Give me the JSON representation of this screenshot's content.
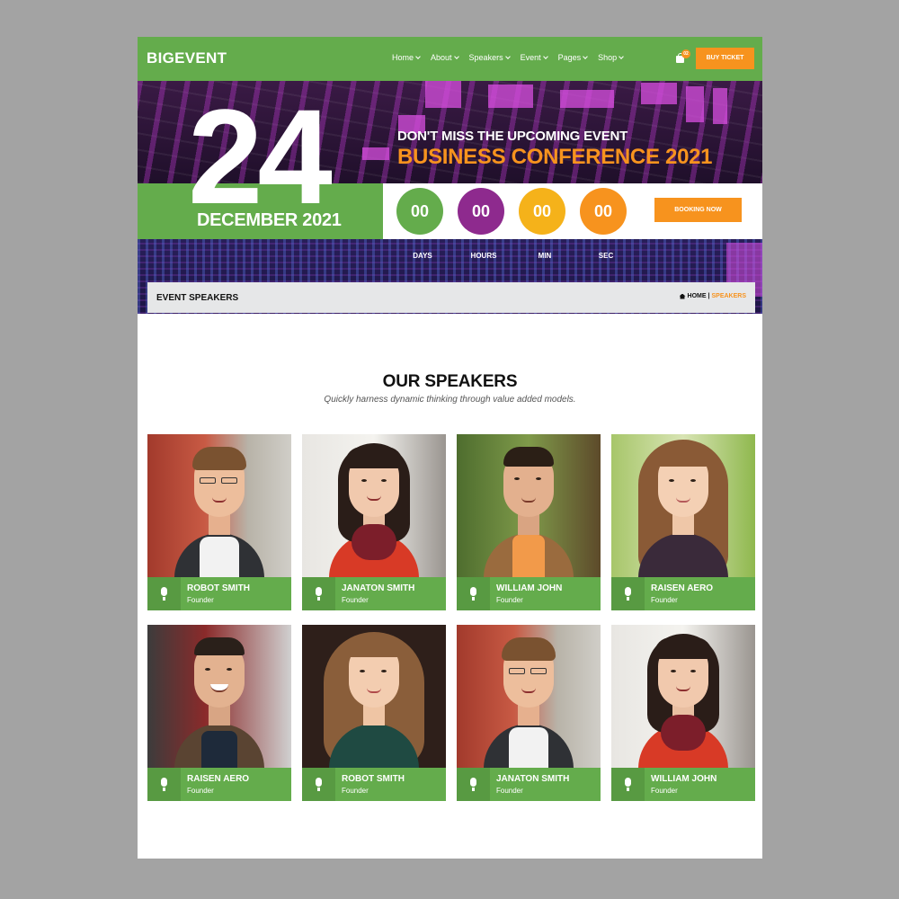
{
  "header": {
    "logo": "BIGEVENT",
    "nav": [
      "Home",
      "About",
      "Speakers",
      "Event",
      "Pages",
      "Shop"
    ],
    "cart_count": "02",
    "buy_ticket": "BUY TICKET"
  },
  "hero": {
    "day": "24",
    "month_year": "DECEMBER 2021",
    "subtitle": "DON'T MISS THE UPCOMING EVENT",
    "title": "BUSINESS CONFERENCE 2021",
    "countdown": [
      {
        "value": "00",
        "label": "DAYS",
        "color": "#64ac4c"
      },
      {
        "value": "00",
        "label": "HOURS",
        "color": "#8e2a8e"
      },
      {
        "value": "00",
        "label": "MIN",
        "color": "#f5b21a"
      },
      {
        "value": "00",
        "label": "SEC",
        "color": "#f7931e"
      }
    ],
    "booking": "BOOKING NOW"
  },
  "breadcrumb": {
    "title": "EVENT SPEAKERS",
    "home": "HOME",
    "separator": "|",
    "current": "SPEAKERS"
  },
  "speakers_section": {
    "title": "OUR SPEAKERS",
    "subtitle": "Quickly harness dynamic thinking through value added models."
  },
  "speakers": [
    {
      "name": "ROBOT SMITH",
      "role": "Founder"
    },
    {
      "name": "JANATON SMITH",
      "role": "Founder"
    },
    {
      "name": "WILLIAM JOHN",
      "role": "Founder"
    },
    {
      "name": "RAISEN AERO",
      "role": "Founder"
    },
    {
      "name": "RAISEN AERO",
      "role": "Founder"
    },
    {
      "name": "ROBOT SMITH",
      "role": "Founder"
    },
    {
      "name": "JANATON SMITH",
      "role": "Founder"
    },
    {
      "name": "WILLIAM JOHN",
      "role": "Founder"
    }
  ],
  "colors": {
    "brand_green": "#64ac4c",
    "accent_orange": "#f7931e",
    "purple": "#8e2a8e"
  }
}
